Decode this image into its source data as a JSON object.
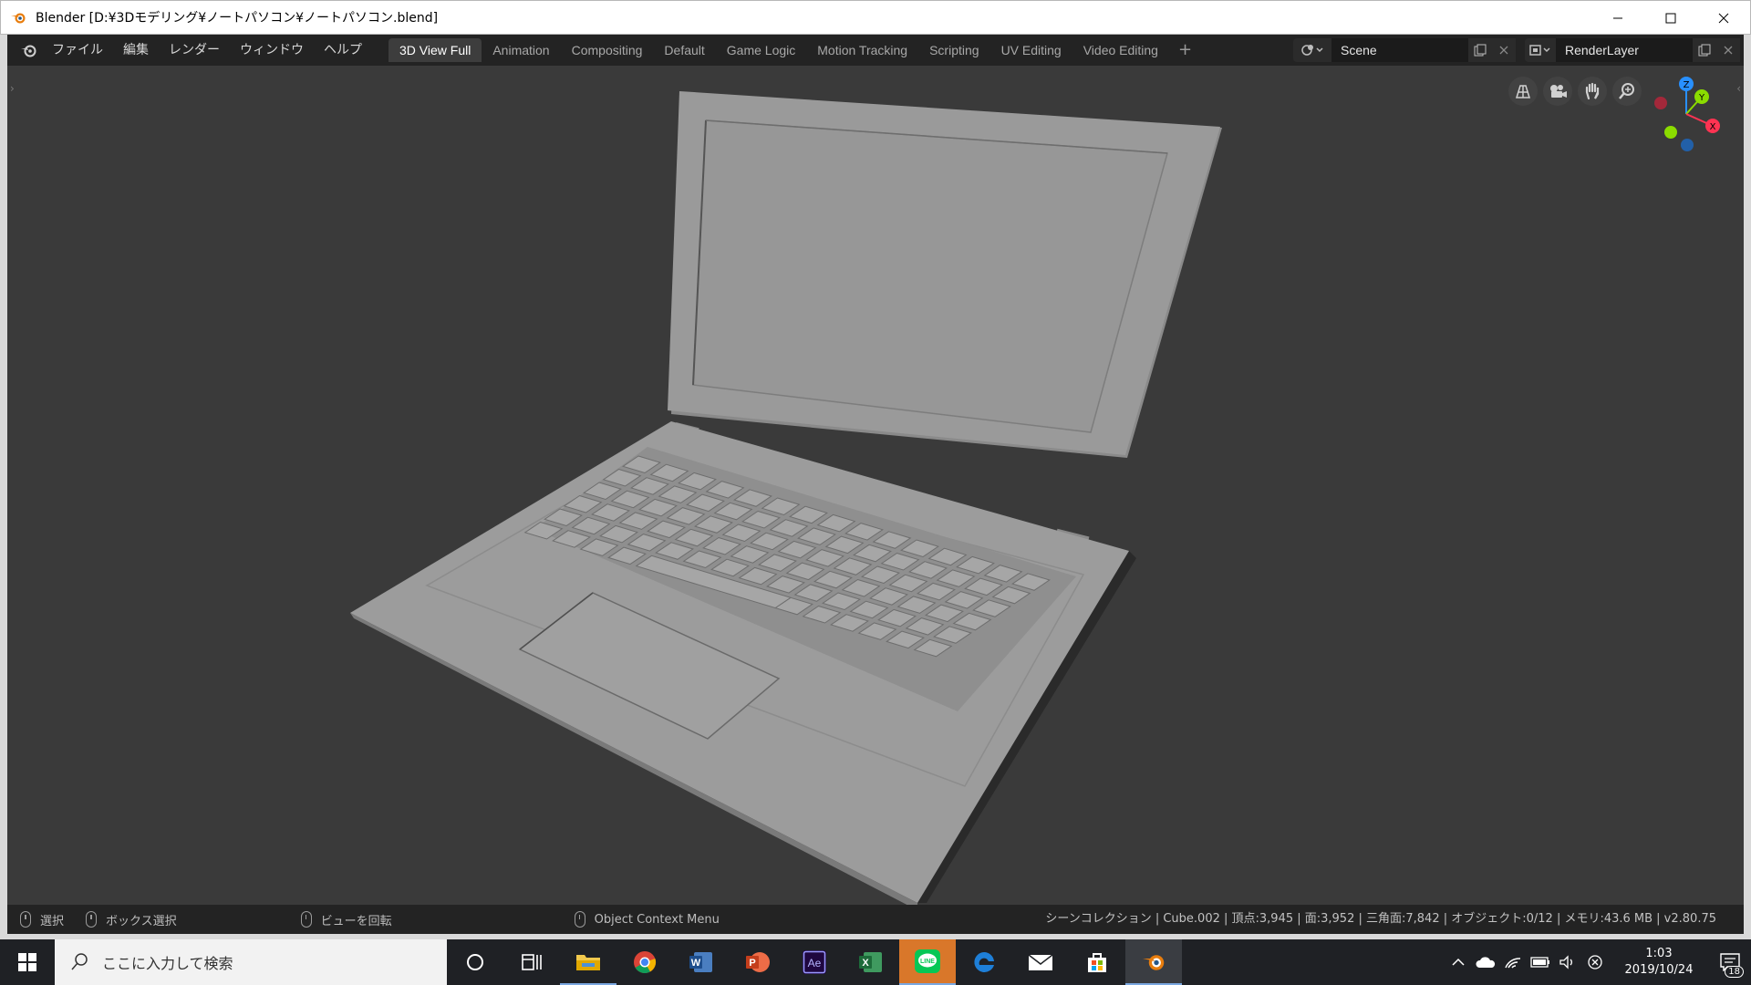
{
  "window": {
    "title": "Blender [D:¥3Dモデリング¥ノートパソコン¥ノートパソコン.blend]",
    "controls": [
      "minimize-icon",
      "maximize-icon",
      "close-icon"
    ]
  },
  "menu": {
    "items": [
      "ファイル",
      "編集",
      "レンダー",
      "ウィンドウ",
      "ヘルプ"
    ]
  },
  "workspaces": {
    "tabs": [
      {
        "label": "3D View Full",
        "active": true
      },
      {
        "label": "Animation",
        "active": false
      },
      {
        "label": "Compositing",
        "active": false
      },
      {
        "label": "Default",
        "active": false
      },
      {
        "label": "Game Logic",
        "active": false
      },
      {
        "label": "Motion Tracking",
        "active": false
      },
      {
        "label": "Scripting",
        "active": false
      },
      {
        "label": "UV Editing",
        "active": false
      },
      {
        "label": "Video Editing",
        "active": false
      }
    ],
    "add_label": "+"
  },
  "scene": {
    "name": "Scene"
  },
  "render_layer": {
    "name": "RenderLayer"
  },
  "viewport": {
    "background": "#3a3a3a",
    "nav_tools": [
      "grid-view-icon",
      "camera-icon",
      "hand-pan-icon",
      "zoom-icon"
    ],
    "gizmo": {
      "z": "Z",
      "y": "Y",
      "x": "X"
    },
    "object": "laptop-model"
  },
  "status": {
    "select": "選択",
    "box_select": "ボックス選択",
    "rotate_view": "ビューを回転",
    "context_menu": "Object Context Menu",
    "stats": "シーンコレクション | Cube.002 | 頂点:3,945 | 面:3,952 | 三角面:7,842 | オブジェクト:0/12 | メモリ:43.6 MB | v2.80.75"
  },
  "taskbar": {
    "search_placeholder": "ここに入力して検索",
    "apps": [
      "cortana-icon",
      "task-view-icon",
      "file-explorer-icon",
      "chrome-icon",
      "word-icon",
      "powerpoint-icon",
      "after-effects-icon",
      "excel-icon",
      "line-icon",
      "edge-icon",
      "mail-icon",
      "store-icon",
      "blender-icon"
    ],
    "ae_label": "Ae",
    "word_label": "W",
    "ppt_label": "P",
    "excel_label": "X",
    "line_label": "LINE",
    "time": "1:03",
    "date": "2019/10/24",
    "notifications": "18"
  },
  "colors": {
    "accent_blue": "#4772b3",
    "gizmo_x": "#ff3352",
    "gizmo_y": "#8bdc00",
    "gizmo_z": "#2890ff"
  }
}
